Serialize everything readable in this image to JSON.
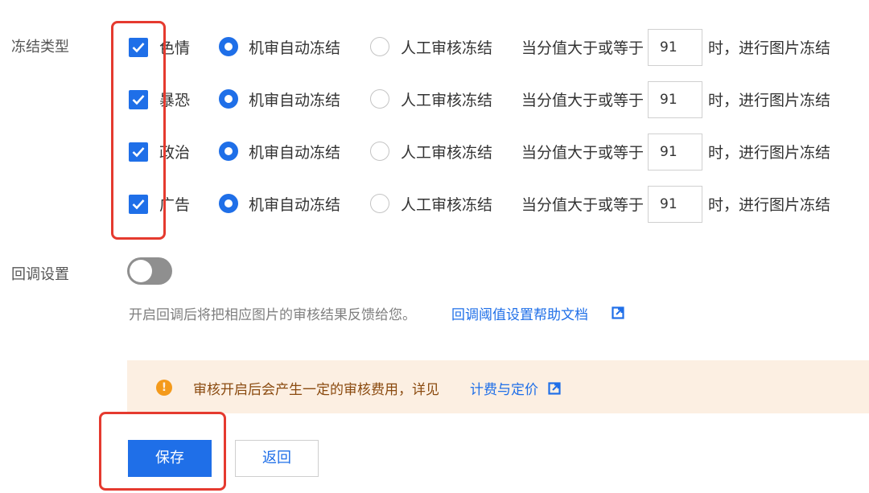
{
  "freeze": {
    "section_label": "冻结类型",
    "rows": [
      {
        "type": "色情",
        "checked": true,
        "auto_label": "机审自动冻结",
        "manual_label": "人工审核冻结",
        "selected": "auto",
        "score_prefix": "当分值大于或等于",
        "score": "91",
        "score_suffix": "时，进行图片冻结"
      },
      {
        "type": "暴恐",
        "checked": true,
        "auto_label": "机审自动冻结",
        "manual_label": "人工审核冻结",
        "selected": "auto",
        "score_prefix": "当分值大于或等于",
        "score": "91",
        "score_suffix": "时，进行图片冻结"
      },
      {
        "type": "政治",
        "checked": true,
        "auto_label": "机审自动冻结",
        "manual_label": "人工审核冻结",
        "selected": "auto",
        "score_prefix": "当分值大于或等于",
        "score": "91",
        "score_suffix": "时，进行图片冻结"
      },
      {
        "type": "广告",
        "checked": true,
        "auto_label": "机审自动冻结",
        "manual_label": "人工审核冻结",
        "selected": "auto",
        "score_prefix": "当分值大于或等于",
        "score": "91",
        "score_suffix": "时，进行图片冻结"
      }
    ]
  },
  "callback": {
    "section_label": "回调设置",
    "enabled": false,
    "hint": "开启回调后将把相应图片的审核结果反馈给您。",
    "help_link": "回调阈值设置帮助文档"
  },
  "notice": {
    "text": "审核开启后会产生一定的审核费用，详见",
    "link": "计费与定价",
    "icon": "warning-circle-icon"
  },
  "actions": {
    "save_label": "保存",
    "back_label": "返回"
  },
  "colors": {
    "primary": "#1f6fe8",
    "highlight": "#e53a2f",
    "notice_bg": "#fcefe2",
    "warning": "#f49a1b"
  }
}
